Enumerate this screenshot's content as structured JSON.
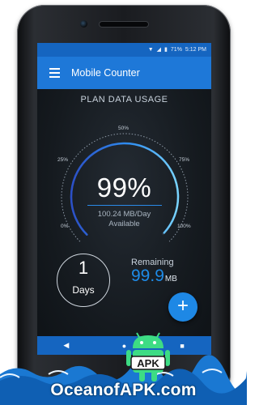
{
  "status_bar": {
    "battery": "71%",
    "time": "5:12 PM",
    "icons": [
      "wifi-icon",
      "signal-icon",
      "battery-icon"
    ]
  },
  "app_bar": {
    "title": "Mobile Counter",
    "menu_icon": "hamburger-menu-icon"
  },
  "gauge": {
    "title": "PLAN DATA USAGE",
    "ticks": [
      "0%",
      "25%",
      "50%",
      "75%",
      "100%"
    ],
    "value_text": "99%",
    "value": 99,
    "per_day": "100.24 MB/Day",
    "available": "Available"
  },
  "days": {
    "count": "1",
    "label": "Days"
  },
  "remaining": {
    "label": "Remaining",
    "value": "99.9",
    "unit": "MB"
  },
  "fab": {
    "icon": "plus-icon",
    "label": "+"
  },
  "nav": {
    "back": "◀",
    "home": "●",
    "recents": "■"
  },
  "watermark": {
    "text": "OceanofAPK.com",
    "badge": "APK"
  },
  "colors": {
    "accent": "#1e78d8",
    "status_bar": "#1565c0",
    "highlight": "#1e8be8"
  }
}
